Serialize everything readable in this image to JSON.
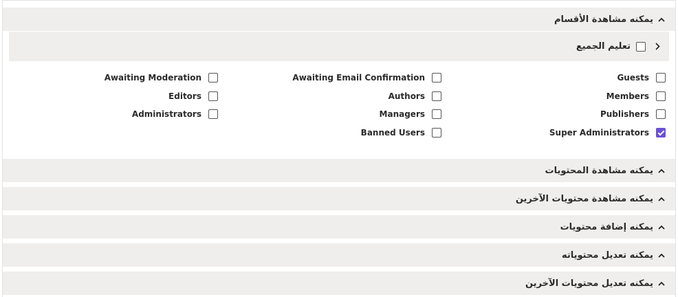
{
  "sections": [
    {
      "title": "يمكنه مشاهدة الأقسام"
    },
    {
      "title": "يمكنه مشاهدة المحتويات"
    },
    {
      "title": "يمكنه مشاهدة محتويات الآخرين"
    },
    {
      "title": "يمكنه إضافة محتويات"
    },
    {
      "title": "يمكنه تعديل محتوياته"
    },
    {
      "title": "يمكنه تعديل محتويات الآخرين"
    }
  ],
  "select_all": {
    "label": "تعليم الجميع",
    "checked": false
  },
  "groups": [
    {
      "label": "Guests",
      "checked": false
    },
    {
      "label": "Members",
      "checked": false
    },
    {
      "label": "Publishers",
      "checked": false
    },
    {
      "label": "Super Administrators",
      "checked": true
    },
    {
      "label": "Awaiting Email Confirmation",
      "checked": false
    },
    {
      "label": "Authors",
      "checked": false
    },
    {
      "label": "Managers",
      "checked": false
    },
    {
      "label": "Banned Users",
      "checked": false
    },
    {
      "label": "Awaiting Moderation",
      "checked": false
    },
    {
      "label": "Editors",
      "checked": false
    },
    {
      "label": "Administrators",
      "checked": false
    }
  ],
  "colors": {
    "header_bg": "#efeeec",
    "accent": "#6b4fd6"
  }
}
